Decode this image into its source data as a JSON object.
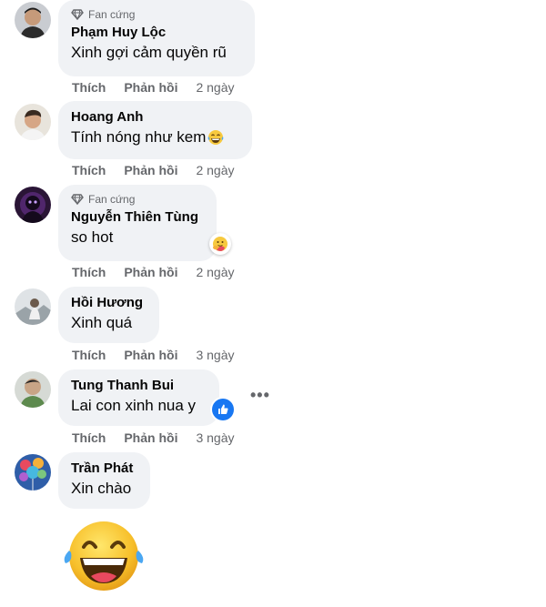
{
  "actions": {
    "like": "Thích",
    "reply": "Phản hồi"
  },
  "comments": [
    {
      "badge": "Fan cứng",
      "author": "Phạm Huy Lộc",
      "text": "Xinh gợi cảm quyền rũ",
      "time": "2 ngày"
    },
    {
      "author": "Hoang Anh",
      "text": "Tính nóng như kem",
      "time": "2 ngày"
    },
    {
      "badge": "Fan cứng",
      "author": "Nguyễn Thiên Tùng",
      "text": "so hot",
      "time": "2 ngày"
    },
    {
      "author": "Hồi Hương",
      "text": "Xinh quá",
      "time": "3 ngày"
    },
    {
      "author": "Tung Thanh Bui",
      "text": "Lai con xinh nua y",
      "time": "3 ngày"
    },
    {
      "author": "Trần Phát",
      "text": "Xin chào"
    }
  ],
  "colors": {
    "bubble": "#f0f2f5",
    "muted": "#65676b",
    "like_blue": "#1877f2"
  },
  "icons": {
    "badge": "diamond-icon",
    "emoji_inline": "laughing-tears-emoji-icon",
    "reaction_care": "care-reaction-icon",
    "reaction_like": "like-reaction-icon",
    "more": "more-options-icon",
    "sticker": "laughing-tears-sticker"
  }
}
